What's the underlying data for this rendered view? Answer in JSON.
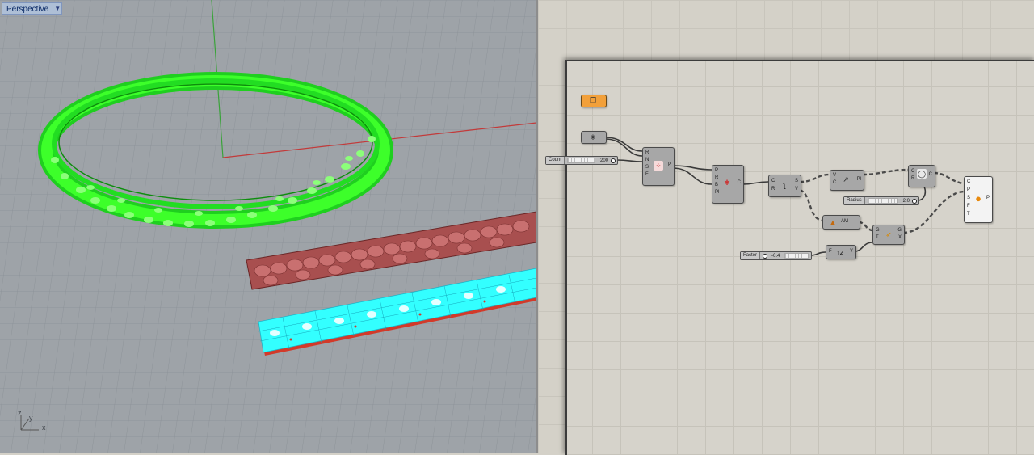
{
  "viewport": {
    "tab_label": "Perspective",
    "axis_labels": {
      "x": "x",
      "y": "y",
      "z": "z"
    }
  },
  "grasshopper": {
    "sliders": {
      "count": {
        "name": "Count",
        "value": "200"
      },
      "radius": {
        "name": "Radius",
        "value": "2.0"
      },
      "factor": {
        "name": "Factor",
        "value": "-0.4"
      }
    },
    "ports": {
      "populate": {
        "inputs": [
          "R",
          "N",
          "S",
          "F"
        ],
        "outputs": [
          "P"
        ]
      },
      "closest": {
        "inputs": [
          "P",
          "R",
          "B",
          "Pl"
        ],
        "outputs": [
          "C"
        ]
      },
      "curve": {
        "inputs": [
          "C",
          "R"
        ],
        "outputs": [
          "S",
          "V"
        ]
      },
      "vector": {
        "inputs": [
          "V",
          "C"
        ],
        "outputs": [
          "Pl"
        ]
      },
      "circle": {
        "inputs": [
          "C",
          "R"
        ],
        "outputs": [
          "C"
        ]
      },
      "amplitude": {
        "label": "AM"
      },
      "graph": {
        "inputs": [
          "G",
          "T"
        ],
        "outputs": [
          "G",
          "X"
        ]
      },
      "multiply": {
        "inputs": [
          "F"
        ],
        "outputs": [
          "Y"
        ]
      },
      "output": {
        "inputs": [
          "C",
          "P",
          "S",
          "F",
          "T"
        ],
        "outputs": [
          "P"
        ]
      }
    }
  },
  "colors": {
    "ring_green": "#39ff14",
    "strip_red": "#b65a5a",
    "strip_cyan": "#33ffff",
    "component_gray": "#a7a7a7",
    "param_orange": "#f2a03a"
  }
}
